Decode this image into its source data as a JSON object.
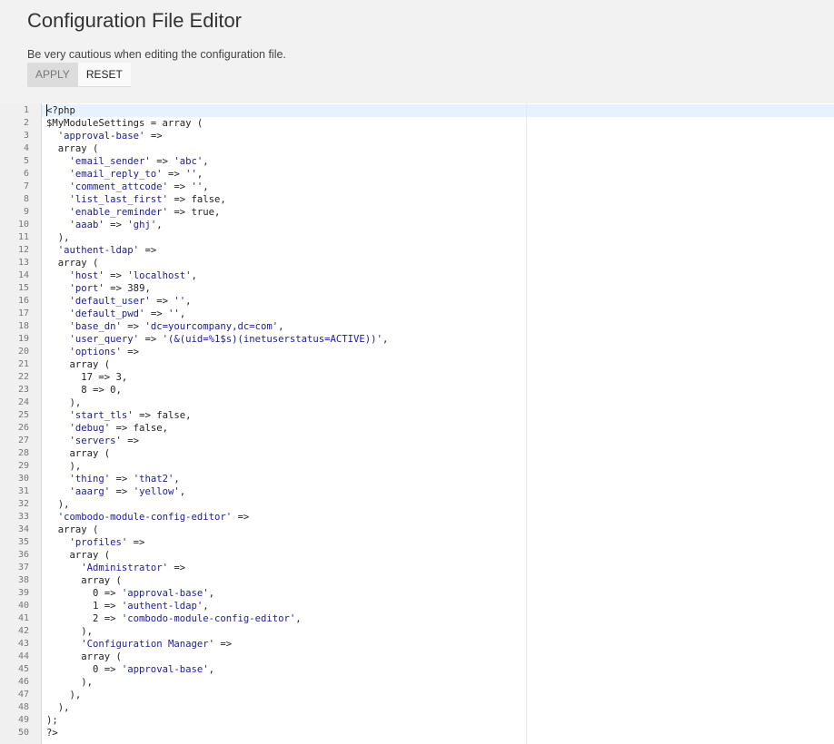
{
  "page": {
    "title": "Configuration File Editor",
    "warning": "Be very cautious when editing the configuration file."
  },
  "toolbar": {
    "apply_label": "APPLY",
    "reset_label": "RESET"
  },
  "editor": {
    "active_line": 1,
    "lines": [
      "<?php",
      "$MyModuleSettings = array (",
      "  'approval-base' =>",
      "  array (",
      "    'email_sender' => 'abc',",
      "    'email_reply_to' => '',",
      "    'comment_attcode' => '',",
      "    'list_last_first' => false,",
      "    'enable_reminder' => true,",
      "    'aaab' => 'ghj',",
      "  ),",
      "  'authent-ldap' =>",
      "  array (",
      "    'host' => 'localhost',",
      "    'port' => 389,",
      "    'default_user' => '',",
      "    'default_pwd' => '',",
      "    'base_dn' => 'dc=yourcompany,dc=com',",
      "    'user_query' => '(&(uid=%1$s)(inetuserstatus=ACTIVE))',",
      "    'options' =>",
      "    array (",
      "      17 => 3,",
      "      8 => 0,",
      "    ),",
      "    'start_tls' => false,",
      "    'debug' => false,",
      "    'servers' =>",
      "    array (",
      "    ),",
      "    'thing' => 'that2',",
      "    'aaarg' => 'yellow',",
      "  ),",
      "  'combodo-module-config-editor' =>",
      "  array (",
      "    'profiles' =>",
      "    array (",
      "      'Administrator' =>",
      "      array (",
      "        0 => 'approval-base',",
      "        1 => 'authent-ldap',",
      "        2 => 'combodo-module-config-editor',",
      "      ),",
      "      'Configuration Manager' =>",
      "      array (",
      "        0 => 'approval-base',",
      "      ),",
      "    ),",
      "  ),",
      ");",
      "?>"
    ]
  }
}
